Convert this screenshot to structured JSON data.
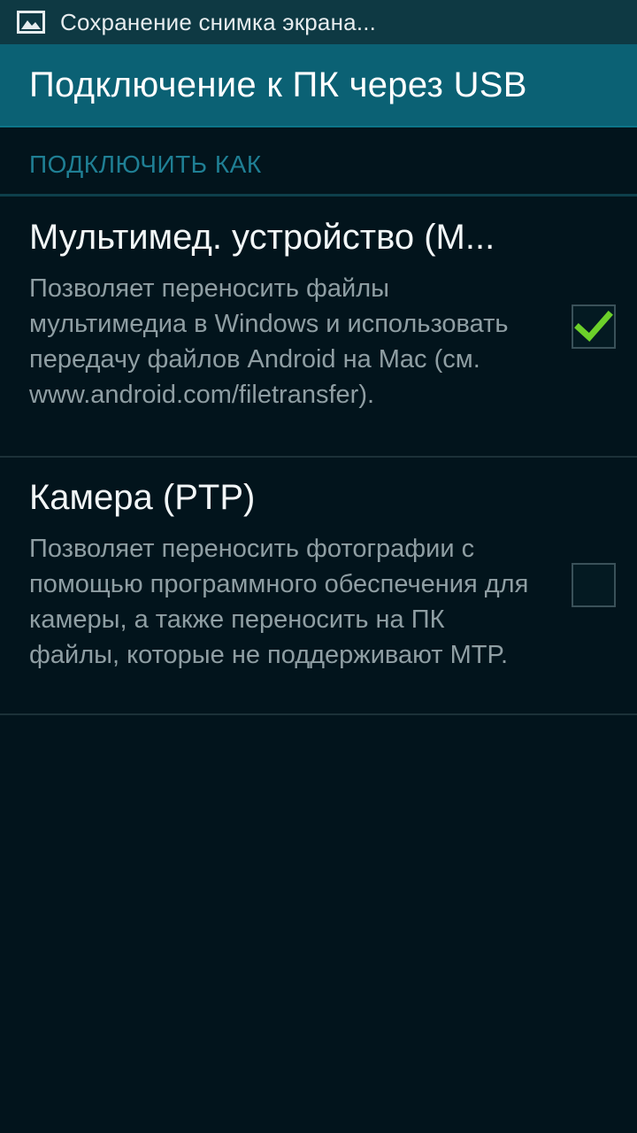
{
  "status_bar": {
    "notification_icon": "image-icon",
    "text": "Сохранение снимка экрана..."
  },
  "header": {
    "title": "Подключение к ПК через USB"
  },
  "section": {
    "label": "ПОДКЛЮЧИТЬ КАК"
  },
  "options": [
    {
      "title": "Мультимед. устройство (M...",
      "description": "Позволяет переносить файлы мультимедиа в Windows и использовать передачу файлов Android на Mac (см. www.android.com/filetransfer).",
      "checked": true
    },
    {
      "title": "Камера (PTP)",
      "description": "Позволяет переносить фотографии с помощью программного обеспечения для камеры, а также переносить на ПК файлы, которые не поддерживают MTP.",
      "checked": false
    }
  ],
  "colors": {
    "background": "#02141c",
    "status_bar": "#0e3943",
    "title_bar": "#0b6174",
    "accent": "#1f7f94",
    "check": "#6cd02a"
  }
}
